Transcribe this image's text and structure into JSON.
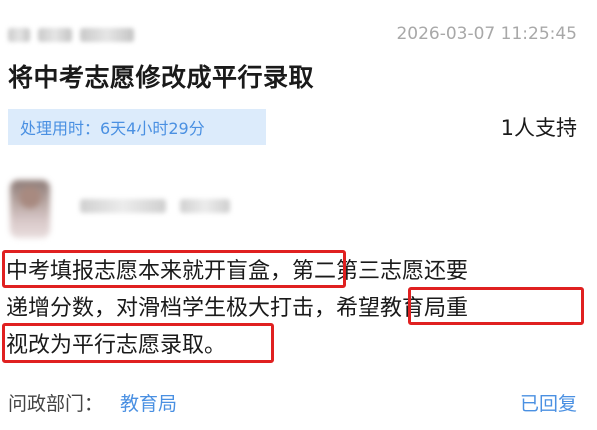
{
  "post": {
    "timestamp": "2026-03-07 11:25:45",
    "title": "将中考志愿修改成平行录取",
    "processing_time": "处理用时：6天4小时29分",
    "support_count": "1人支持"
  },
  "comment": {
    "line1_hl": "中考填报志愿本来就开盲盒，",
    "line1_rest": "第二第三志愿还要",
    "line2_lead": "递增分数，对滑档学生极大打击，",
    "line2_hl": "希望教育局重",
    "line3_hl": "视改为平行志愿录取。"
  },
  "footer": {
    "dept_label": "问政部门：",
    "dept_name": "教育局",
    "reply_status": "已回复"
  },
  "colors": {
    "accent_blue": "#4a90e2",
    "badge_bg": "#dcebfb",
    "highlight_red": "#e02020"
  }
}
